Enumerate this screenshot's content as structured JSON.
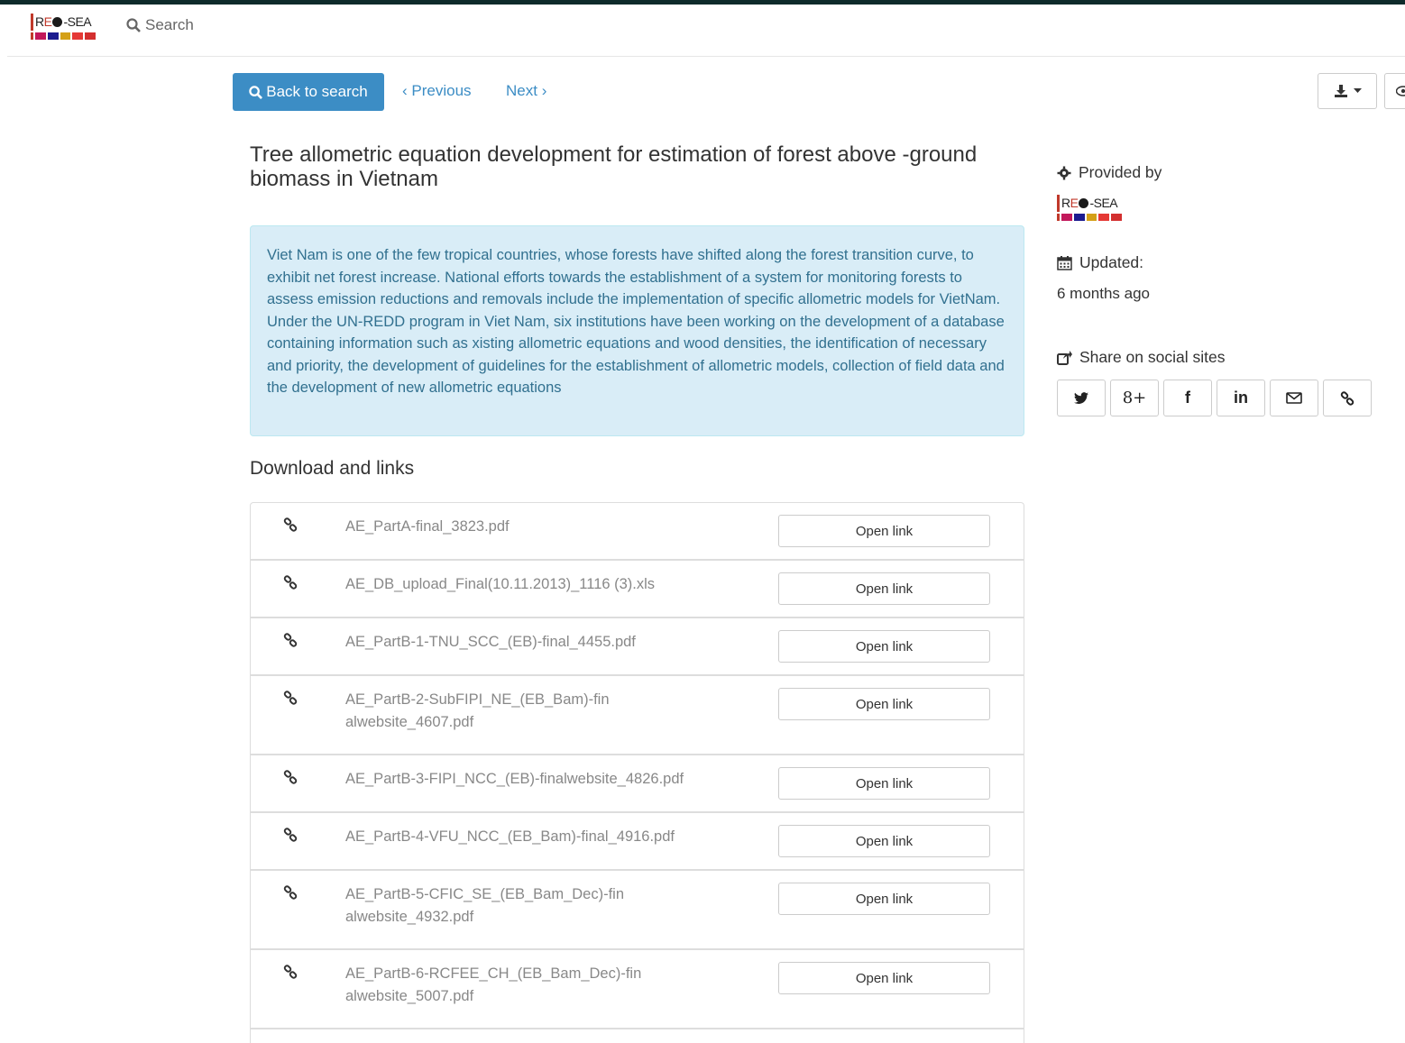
{
  "nav": {
    "logo_text": "RE-SEA",
    "search_label": "Search"
  },
  "toolbar": {
    "back_label": "Back to search",
    "previous_label": "Previous",
    "next_label": "Next"
  },
  "record": {
    "title": "Tree allometric equation development for estimation of forest above -ground biomass in Vietnam",
    "abstract": "Viet Nam is one of the few tropical countries, whose forests have shifted along the forest transition curve, to exhibit net forest increase. National efforts towards the establishment of a system for monitoring forests to assess emission reductions and removals include the implementation of specific allometric models for VietNam. Under the UN-REDD program in Viet Nam, six institutions have been working on the development of a database containing information such as xisting allometric equations and wood densities, the identification of necessary and priority, the development of guidelines for the establishment of allometric models, collection of field data and the development of new allometric equations"
  },
  "downloads": {
    "heading": "Download and links",
    "open_label": "Open link",
    "items": [
      {
        "name": "AE_PartA-final_3823.pdf"
      },
      {
        "name": "AE_DB_upload_Final(10.11.2013)_1116 (3).xls"
      },
      {
        "name": "AE_PartB-1-TNU_SCC_(EB)-final_4455.pdf"
      },
      {
        "name": "AE_PartB-2-SubFIPI_NE_(EB_Bam)-finalwebsite_4607.pdf"
      },
      {
        "name": "AE_PartB-3-FIPI_NCC_(EB)-finalwebsite_4826.pdf"
      },
      {
        "name": "AE_PartB-4-VFU_NCC_(EB_Bam)-final_4916.pdf"
      },
      {
        "name": "AE_PartB-5-CFIC_SE_(EB_Bam_Dec)-finalwebsite_4932.pdf"
      },
      {
        "name": "AE_PartB-6-RCFEE_CH_(EB_Bam_Dec)-finalwebsite_5007.pdf"
      }
    ]
  },
  "sidebar": {
    "provided_by_label": "Provided by",
    "provider_logo_text": "RE-SEA",
    "updated_label": "Updated:",
    "updated_value": "6 months ago",
    "share_label": "Share on social sites",
    "social": [
      {
        "icon": "twitter-icon",
        "glyph": "🐦"
      },
      {
        "icon": "google-plus-icon",
        "glyph": "8+"
      },
      {
        "icon": "facebook-icon",
        "glyph": "f"
      },
      {
        "icon": "linkedin-icon",
        "glyph": "in"
      },
      {
        "icon": "email-icon",
        "glyph": "✉"
      },
      {
        "icon": "link-icon",
        "glyph": "🔗"
      }
    ]
  },
  "colors": {
    "primary": "#3c8dc5",
    "alert_bg": "#d9edf7",
    "alert_text": "#31708f",
    "topline": "#0e2b2b"
  }
}
